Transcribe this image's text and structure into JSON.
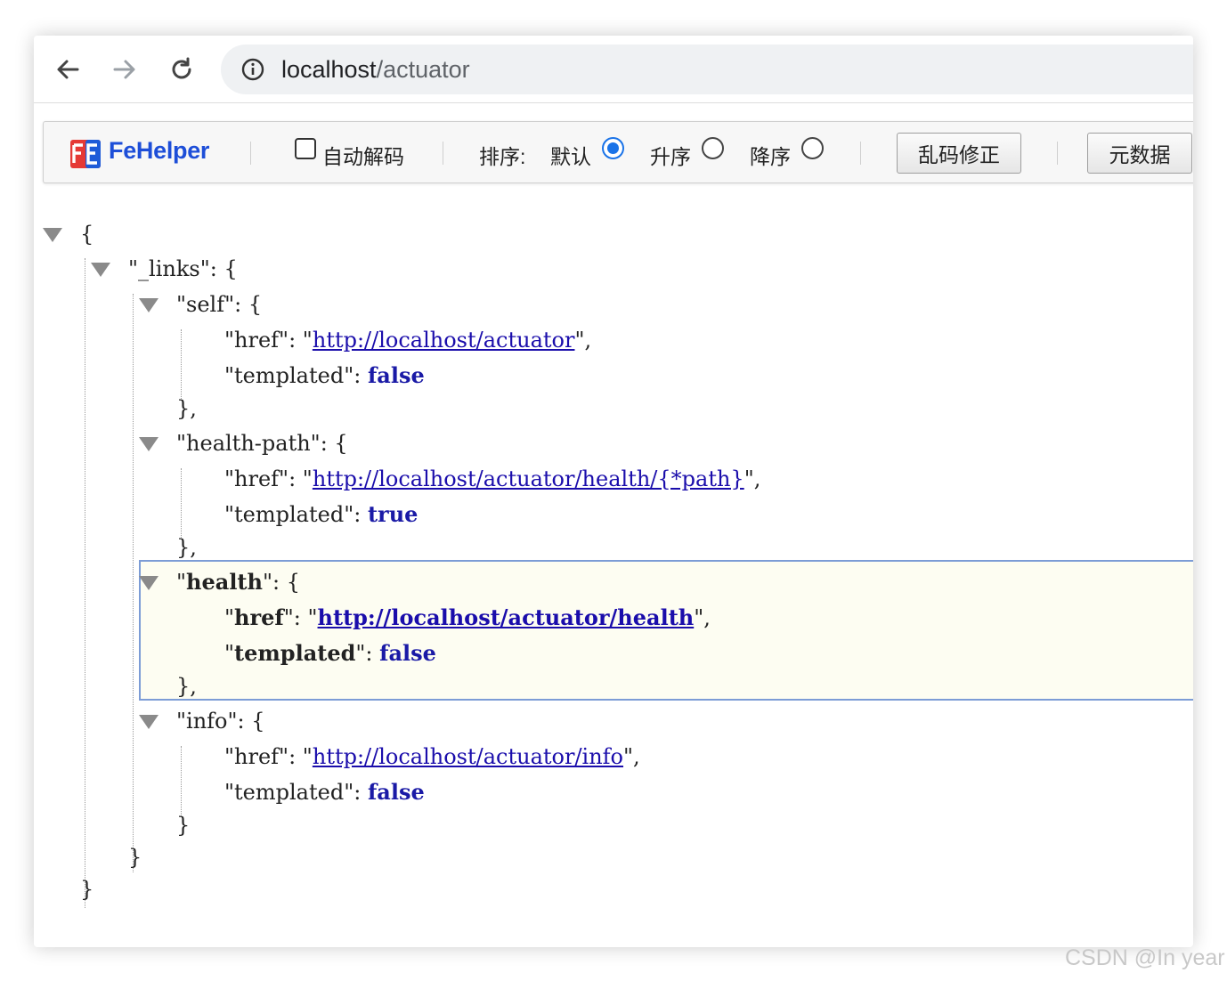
{
  "browser": {
    "url_host": "localhost",
    "url_path": "/actuator"
  },
  "fehelper": {
    "brand": "FeHelper",
    "auto_decode_label": "自动解码",
    "sort_label": "排序:",
    "sort_options": [
      "默认",
      "升序",
      "降序"
    ],
    "sort_selected": "默认",
    "fix_button": "乱码修正",
    "meta_button": "元数据"
  },
  "json": {
    "open_brace": "{",
    "links_key": "\"_links\"",
    "self_key": "\"self\"",
    "self_href_key": "\"href\"",
    "self_href": "http://localhost/actuator",
    "self_templated_key": "\"templated\"",
    "self_templated": "false",
    "health_path_key": "\"health-path\"",
    "health_path_href_key": "\"href\"",
    "health_path_href": "http://localhost/actuator/health/{*path}",
    "health_path_templated_key": "\"templated\"",
    "health_path_templated": "true",
    "health_key": "health",
    "health_href_key": "href",
    "health_href": "http://localhost/actuator/health",
    "health_templated_key": "templated",
    "health_templated": "false",
    "info_key": "\"info\"",
    "info_href_key": "\"href\"",
    "info_href": "http://localhost/actuator/info",
    "info_templated_key": "\"templated\"",
    "info_templated": "false"
  },
  "watermark": "CSDN @In year"
}
